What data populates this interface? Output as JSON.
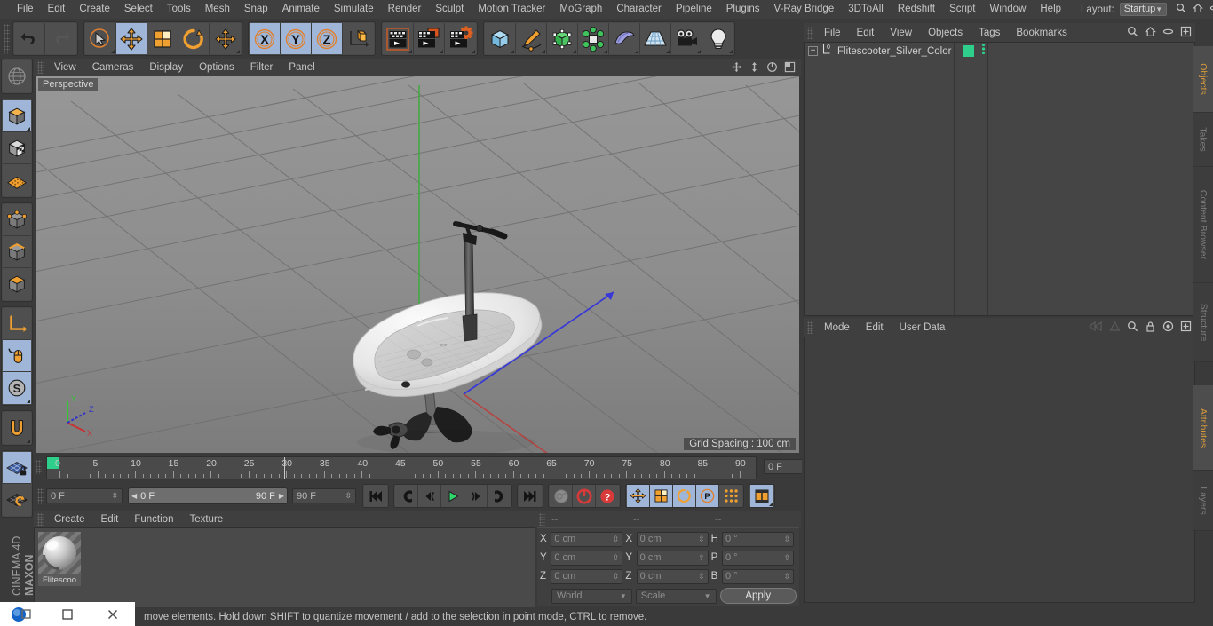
{
  "app": {
    "name": "CINEMA 4D",
    "brand": "MAXON",
    "brand_line2": "CINEMA 4D"
  },
  "menubar": {
    "items": [
      "File",
      "Edit",
      "Create",
      "Select",
      "Tools",
      "Mesh",
      "Snap",
      "Animate",
      "Simulate",
      "Render",
      "Sculpt",
      "Motion Tracker",
      "MoGraph",
      "Character",
      "Pipeline",
      "Plugins",
      "V-Ray Bridge",
      "3DToAll",
      "Redshift",
      "Script",
      "Window",
      "Help"
    ],
    "layout_label": "Layout:",
    "layout_value": "Startup",
    "icons": [
      "search-icon",
      "home-icon",
      "minimize-icon",
      "maximize-icon"
    ]
  },
  "toolbar": {
    "groups": [
      {
        "name": "history",
        "buttons": [
          {
            "icon": "undo-icon",
            "label": "Undo",
            "active": false
          },
          {
            "icon": "redo-icon",
            "label": "Redo",
            "active": false
          }
        ]
      },
      {
        "name": "selection-transform",
        "buttons": [
          {
            "icon": "live-selection-icon",
            "label": "Live Selection",
            "active": false
          },
          {
            "icon": "move-icon",
            "label": "Move",
            "active": true
          },
          {
            "icon": "scale-icon",
            "label": "Scale",
            "active": false
          },
          {
            "icon": "rotate-icon",
            "label": "Rotate",
            "active": false
          },
          {
            "icon": "move-axis-icon",
            "label": "Move Axis",
            "active": false
          }
        ]
      },
      {
        "name": "axis-locks",
        "buttons": [
          {
            "icon": "x-axis-icon",
            "label": "X",
            "active": true
          },
          {
            "icon": "y-axis-icon",
            "label": "Y",
            "active": true
          },
          {
            "icon": "z-axis-icon",
            "label": "Z",
            "active": true
          },
          {
            "icon": "world-coordinate-icon",
            "label": "World/Object",
            "active": false
          }
        ]
      },
      {
        "name": "render",
        "buttons": [
          {
            "icon": "render-view-icon",
            "label": "Render View",
            "active": false
          },
          {
            "icon": "render-region-icon",
            "label": "Render to Picture Viewer",
            "active": false
          },
          {
            "icon": "render-settings-icon",
            "label": "Edit Render Settings",
            "active": false
          }
        ]
      },
      {
        "name": "create-objects",
        "buttons": [
          {
            "icon": "cube-primitive-icon",
            "label": "Add Cube Object",
            "active": false
          },
          {
            "icon": "spline-pen-icon",
            "label": "Add Spline",
            "active": false
          },
          {
            "icon": "generator-icon",
            "label": "Add Generator",
            "active": false
          },
          {
            "icon": "deformer-icon",
            "label": "Add Deformer",
            "active": false
          },
          {
            "icon": "scene-object-icon",
            "label": "Add Scene Object",
            "active": false
          },
          {
            "icon": "floor-icon",
            "label": "Add Floor",
            "active": false
          },
          {
            "icon": "camera-icon",
            "label": "Add Camera",
            "active": false
          },
          {
            "icon": "light-icon",
            "label": "Add Light",
            "active": false
          }
        ]
      }
    ]
  },
  "lefttool": {
    "groups": [
      {
        "buttons": [
          {
            "icon": "undo-view-icon",
            "label": "Undo View",
            "active": false
          }
        ]
      },
      {
        "buttons": [
          {
            "icon": "model-mode-icon",
            "label": "Model Mode",
            "active": true
          },
          {
            "icon": "texture-mode-icon",
            "label": "Texture Mode",
            "active": false
          },
          {
            "icon": "workplane-mode-icon",
            "label": "Workplane Mode",
            "active": false
          }
        ]
      },
      {
        "buttons": [
          {
            "icon": "points-mode-icon",
            "label": "Points",
            "active": false
          },
          {
            "icon": "edges-mode-icon",
            "label": "Edges",
            "active": false
          },
          {
            "icon": "polygons-mode-icon",
            "label": "Polygons",
            "active": false
          }
        ]
      },
      {
        "buttons": [
          {
            "icon": "object-axis-icon",
            "label": "Enable Axis Modification",
            "active": false
          },
          {
            "icon": "viewport-solo-icon",
            "label": "Viewport Solo",
            "active": true
          },
          {
            "icon": "soft-selection-icon",
            "label": "Soft Selection",
            "active": true
          }
        ]
      },
      {
        "buttons": [
          {
            "icon": "magnet-icon",
            "label": "Magnet",
            "active": false
          }
        ]
      },
      {
        "buttons": [
          {
            "icon": "workplane-lock-icon",
            "label": "Lock Workplane",
            "active": true
          },
          {
            "icon": "planar-workplane-icon",
            "label": "Planar Workplane",
            "active": false
          }
        ]
      }
    ]
  },
  "viewport": {
    "menu": [
      "View",
      "Cameras",
      "Display",
      "Options",
      "Filter",
      "Panel"
    ],
    "icons": [
      "pan-icon",
      "zoom-icon",
      "rotate-view-icon",
      "maximize-view-icon"
    ],
    "label": "Perspective",
    "grid_spacing": "Grid Spacing : 100 cm",
    "axis_gizmo": {
      "x": "X",
      "y": "Y",
      "z": "Z",
      "x_color": "#c83232",
      "y_color": "#32c832",
      "z_color": "#3232c8"
    },
    "colors": {
      "bg_top": "#909090",
      "bg_bottom": "#7e7e7e",
      "grid_line": "#6a6a6a",
      "axis_x": "#b8413f",
      "axis_y": "#3faa3f",
      "axis_z": "#3a3acf"
    }
  },
  "timeline": {
    "ruler_labels": [
      "0",
      "5",
      "10",
      "15",
      "20",
      "25",
      "30",
      "35",
      "40",
      "45",
      "50",
      "55",
      "60",
      "65",
      "70",
      "75",
      "80",
      "85",
      "90"
    ],
    "start": 0,
    "end": 90,
    "current_frame_field": "0 F",
    "playhead_frame": 0
  },
  "transport": {
    "frame_field": "0 F",
    "range_start": "0 F",
    "range_end": "90 F",
    "end_field": "90 F",
    "buttons": [
      {
        "icon": "go-to-start-icon",
        "label": "Go to Start",
        "active": false
      },
      {
        "icon": "previous-key-icon",
        "label": "Go to Previous Key",
        "active": false
      },
      {
        "icon": "previous-frame-icon",
        "label": "Go to Previous Frame",
        "active": false
      },
      {
        "icon": "play-icon",
        "label": "Play Forwards",
        "active": false
      },
      {
        "icon": "next-frame-icon",
        "label": "Go to Next Frame",
        "active": false
      },
      {
        "icon": "next-key-icon",
        "label": "Go to Next Key",
        "active": false
      },
      {
        "icon": "go-to-end-icon",
        "label": "Go to End",
        "active": false
      },
      {
        "icon": "record-key-icon",
        "label": "Record Active Objects",
        "active": false
      },
      {
        "icon": "autokey-icon",
        "label": "Autokeying",
        "active": false
      },
      {
        "icon": "keyframe-help-icon",
        "label": "Keyframe Selection",
        "active": false
      },
      {
        "icon": "key-position-icon",
        "label": "Position",
        "active": true
      },
      {
        "icon": "key-scale-icon",
        "label": "Scale",
        "active": true
      },
      {
        "icon": "key-rotation-icon",
        "label": "Rotation",
        "active": true
      },
      {
        "icon": "key-param-icon",
        "label": "Parameter",
        "active": true
      },
      {
        "icon": "key-pla-icon",
        "label": "Point Level Animation",
        "active": false
      },
      {
        "icon": "timeline-icon",
        "label": "Timeline",
        "active": true
      }
    ]
  },
  "materials": {
    "menu": [
      "Create",
      "Edit",
      "Function",
      "Texture"
    ],
    "items": [
      {
        "name": "Flitescoo",
        "full_name": "Flitescooter_Silver_Color"
      }
    ]
  },
  "coordinates": {
    "headers": [
      "--",
      "--",
      "--"
    ],
    "rows": [
      {
        "label_pos": "X",
        "pos": "0 cm",
        "label_size": "X",
        "size": "0 cm",
        "label_rot": "H",
        "rot": "0 °"
      },
      {
        "label_pos": "Y",
        "pos": "0 cm",
        "label_size": "Y",
        "size": "0 cm",
        "label_rot": "P",
        "rot": "0 °"
      },
      {
        "label_pos": "Z",
        "pos": "0 cm",
        "label_size": "Z",
        "size": "0 cm",
        "label_rot": "B",
        "rot": "0 °"
      }
    ],
    "system": "World",
    "mode": "Scale",
    "apply": "Apply"
  },
  "object_manager": {
    "menu": [
      "File",
      "Edit",
      "View",
      "Objects",
      "Tags",
      "Bookmarks"
    ],
    "icons": [
      "search-icon",
      "home-icon",
      "ellipse-icon",
      "add-layer-icon"
    ],
    "objects": [
      {
        "name": "Flitescooter_Silver_Color",
        "expander": "+",
        "level_badge": "0",
        "tag_color": "#2ecf8b",
        "has_dots": true
      }
    ]
  },
  "attributes": {
    "menu": [
      "Mode",
      "Edit",
      "User Data"
    ],
    "icons": [
      "left-arrow-icon",
      "up-arrow-icon",
      "search-icon",
      "lock-icon",
      "target-icon",
      "add-icon"
    ],
    "content": ""
  },
  "vtabs_top": [
    {
      "label": "Objects",
      "active": true
    },
    {
      "label": "Takes",
      "active": false
    },
    {
      "label": "Content Browser",
      "active": false
    },
    {
      "label": "Structure",
      "active": false
    }
  ],
  "vtabs_bottom": [
    {
      "label": "Attributes",
      "active": true
    },
    {
      "label": "Layers",
      "active": false
    }
  ],
  "statusbar": {
    "text": "move elements. Hold down SHIFT to quantize movement / add to the selection in point mode, CTRL to remove."
  },
  "taskbar": {
    "items": [
      "app-icon",
      "restore-window-icon",
      "minimize-window-icon",
      "close-window-icon"
    ]
  }
}
